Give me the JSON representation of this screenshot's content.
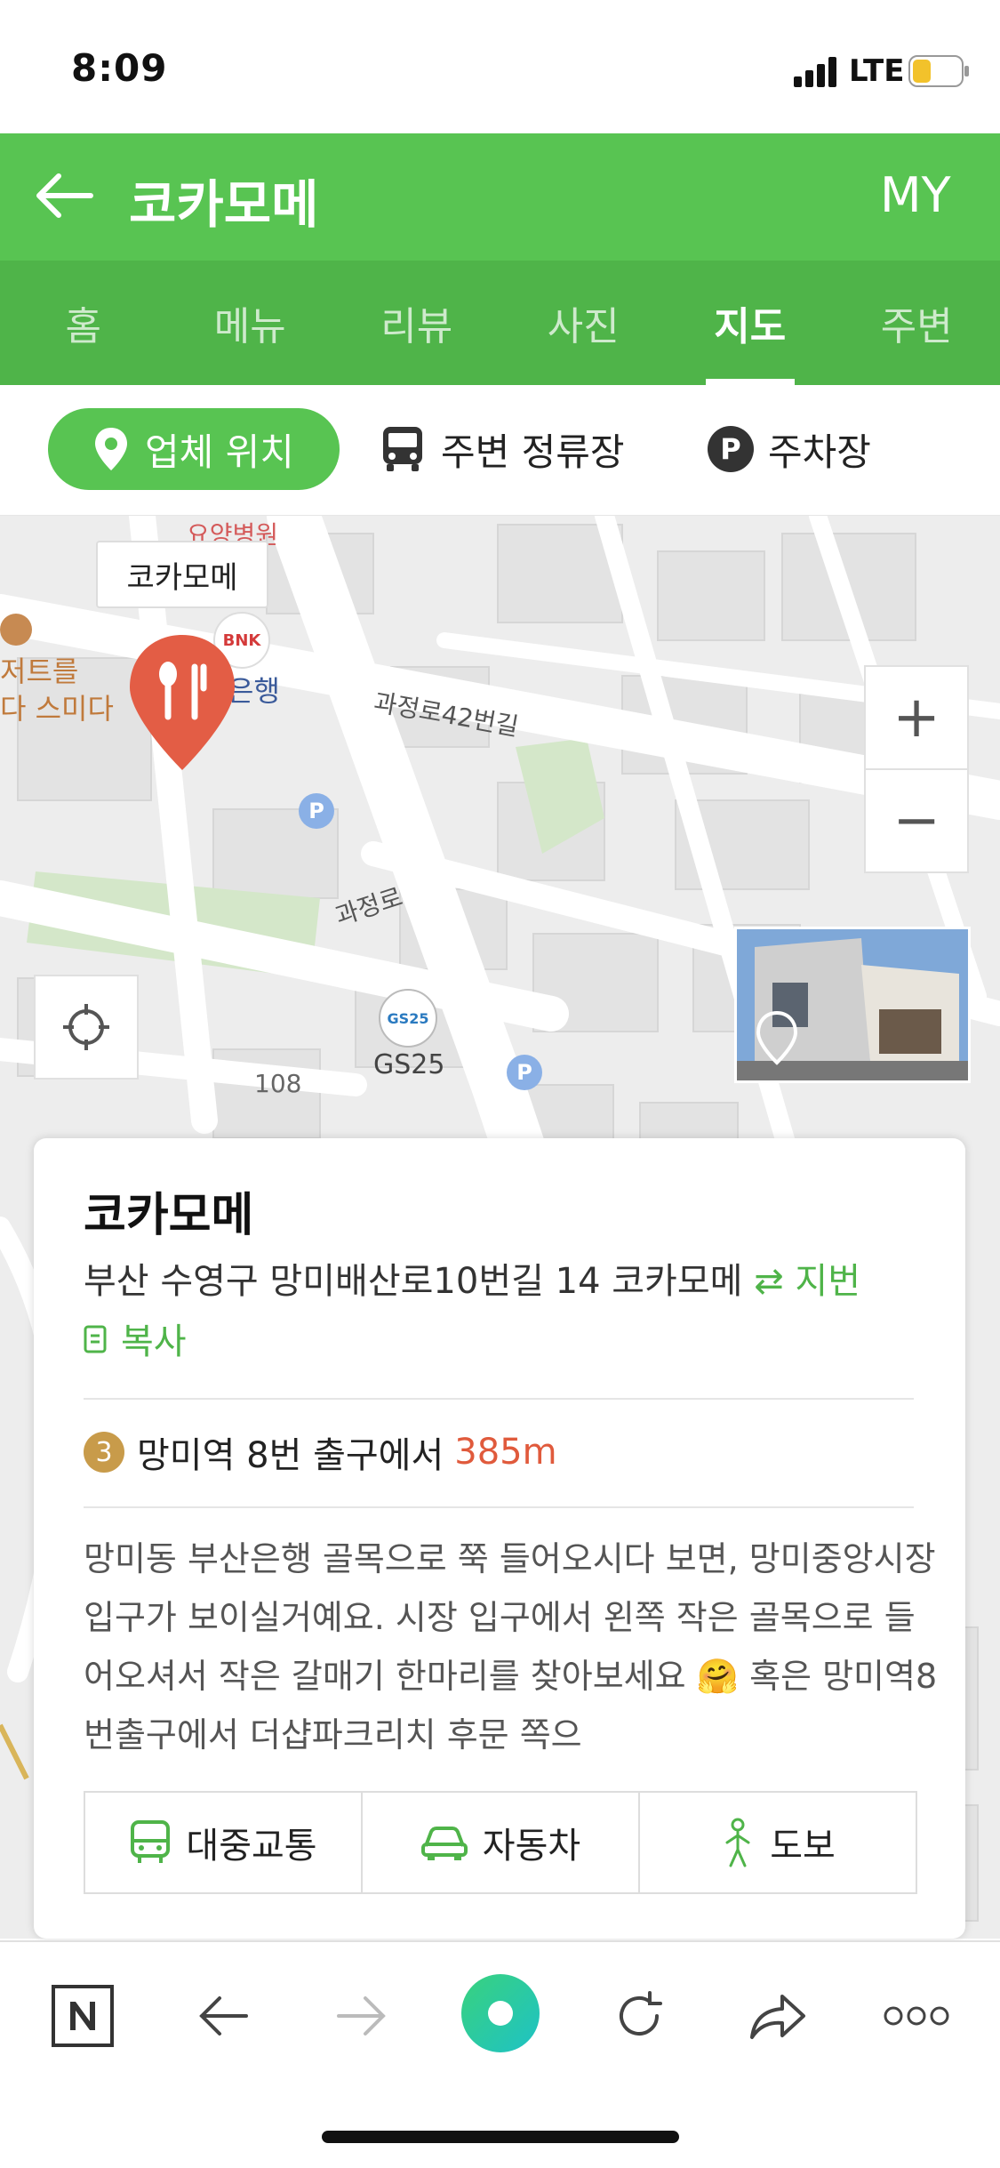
{
  "status": {
    "time": "8:09",
    "network": "LTE"
  },
  "header": {
    "title": "코카모메",
    "my_label": "MY"
  },
  "tabs": [
    {
      "label": "홈"
    },
    {
      "label": "메뉴"
    },
    {
      "label": "리뷰"
    },
    {
      "label": "사진"
    },
    {
      "label": "지도",
      "active": true
    },
    {
      "label": "주변"
    }
  ],
  "filters": {
    "business_location": "업체 위치",
    "nearby_stops": "주변 정류장",
    "parking_badge": "P",
    "parking": "주차장"
  },
  "map": {
    "pin_label": "코카모메",
    "labels": {
      "road1": "과정로42번길",
      "road2": "과정로",
      "gs_logo": "GS25",
      "gs_store": "GS25",
      "bnk": "BNK",
      "bank": "은행",
      "number": "108",
      "hospital": "요양병원",
      "dessert1": "저트를",
      "dessert2": "다 스미다",
      "parking": "P"
    },
    "zoom_in": "+",
    "zoom_out": "−"
  },
  "card": {
    "name": "코카모메",
    "address": "부산 수영구 망미배산로10번길 14 코카모메",
    "lot_label": "지번",
    "copy_label": "복사",
    "station": {
      "line": "3",
      "text": "망미역 8번 출구에서",
      "distance": "385m"
    },
    "description": "망미동 부산은행 골목으로 쭉 들어오시다 보면, 망미중앙시장입구가 보이실거예요. 시장 입구에서 왼쪽 작은 골목으로 들어오셔서 작은 갈매기 한마리를 찾아보세요 🤗 혹은 망미역8번출구에서 더샵파크리치 후문 쪽으",
    "routes": {
      "transit": "대중교통",
      "car": "자동차",
      "walk": "도보"
    }
  },
  "colors": {
    "brand_green": "#58c452",
    "tab_green": "#4fb449",
    "distance_red": "#e05a3c",
    "pin_red": "#e35d45"
  }
}
